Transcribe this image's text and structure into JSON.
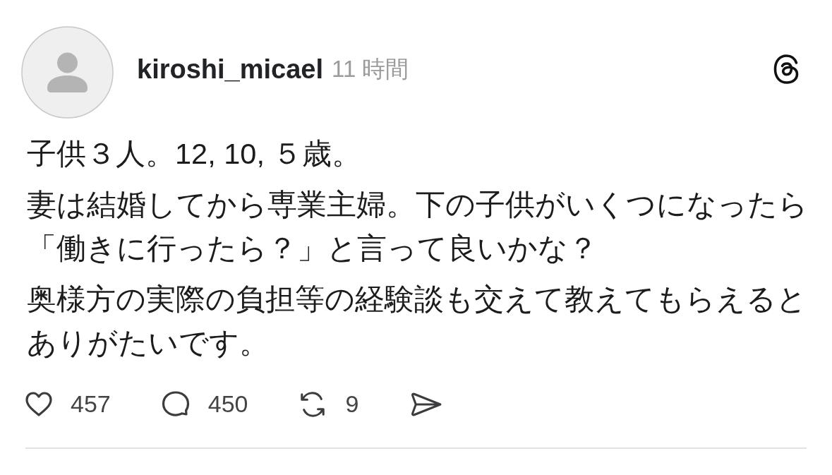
{
  "post": {
    "author": {
      "username": "kiroshi_micael",
      "time": "11 時間"
    },
    "body": [
      [
        "子供３人。12, 10, ５歳。"
      ],
      [
        "妻は結婚してから専業主婦。下の子供がいくつになったら",
        "「働きに行ったら？」と言って良いかな？"
      ],
      [
        "奥様方の実際の負担等の経験談も交えて教えてもらえると",
        "ありがたいです。"
      ]
    ],
    "actions": [
      {
        "kind": "like",
        "count": "457"
      },
      {
        "kind": "reply",
        "count": "450"
      },
      {
        "kind": "repost",
        "count": "9"
      },
      {
        "kind": "share"
      }
    ]
  }
}
